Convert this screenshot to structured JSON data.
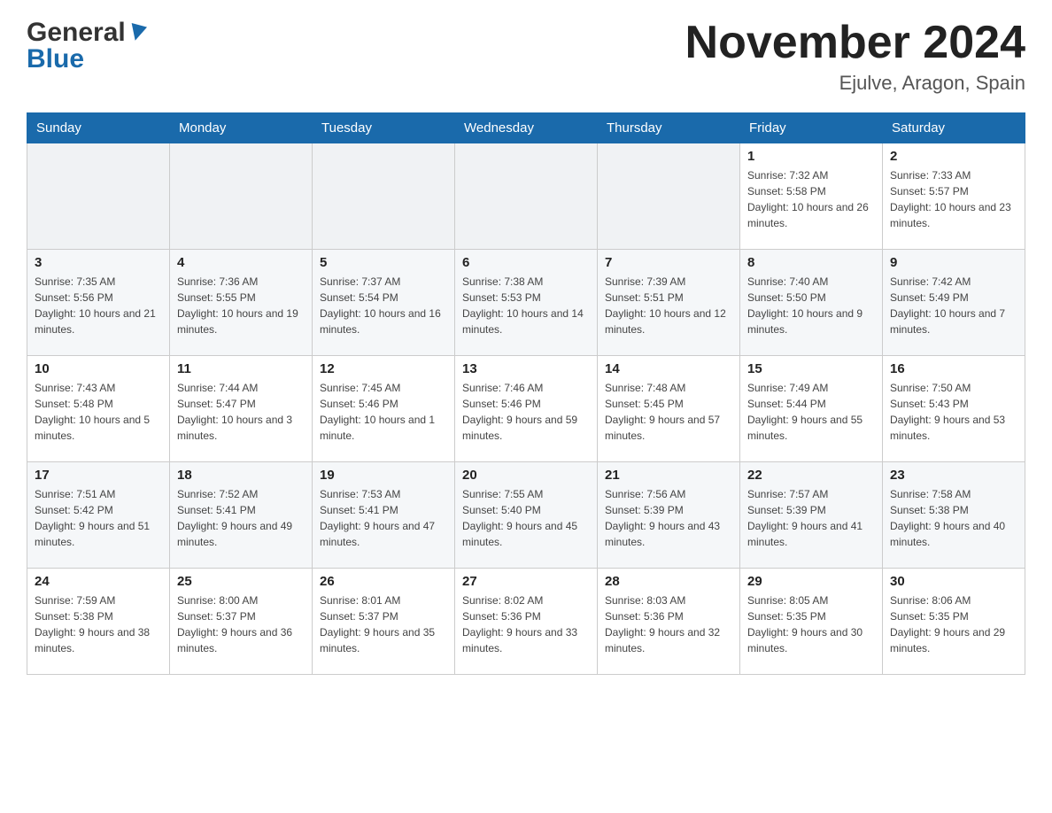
{
  "header": {
    "logo_general": "General",
    "logo_blue": "Blue",
    "month_title": "November 2024",
    "location": "Ejulve, Aragon, Spain"
  },
  "weekdays": [
    "Sunday",
    "Monday",
    "Tuesday",
    "Wednesday",
    "Thursday",
    "Friday",
    "Saturday"
  ],
  "weeks": [
    {
      "days": [
        {
          "date": "",
          "sunrise": "",
          "sunset": "",
          "daylight": ""
        },
        {
          "date": "",
          "sunrise": "",
          "sunset": "",
          "daylight": ""
        },
        {
          "date": "",
          "sunrise": "",
          "sunset": "",
          "daylight": ""
        },
        {
          "date": "",
          "sunrise": "",
          "sunset": "",
          "daylight": ""
        },
        {
          "date": "",
          "sunrise": "",
          "sunset": "",
          "daylight": ""
        },
        {
          "date": "1",
          "sunrise": "Sunrise: 7:32 AM",
          "sunset": "Sunset: 5:58 PM",
          "daylight": "Daylight: 10 hours and 26 minutes."
        },
        {
          "date": "2",
          "sunrise": "Sunrise: 7:33 AM",
          "sunset": "Sunset: 5:57 PM",
          "daylight": "Daylight: 10 hours and 23 minutes."
        }
      ]
    },
    {
      "days": [
        {
          "date": "3",
          "sunrise": "Sunrise: 7:35 AM",
          "sunset": "Sunset: 5:56 PM",
          "daylight": "Daylight: 10 hours and 21 minutes."
        },
        {
          "date": "4",
          "sunrise": "Sunrise: 7:36 AM",
          "sunset": "Sunset: 5:55 PM",
          "daylight": "Daylight: 10 hours and 19 minutes."
        },
        {
          "date": "5",
          "sunrise": "Sunrise: 7:37 AM",
          "sunset": "Sunset: 5:54 PM",
          "daylight": "Daylight: 10 hours and 16 minutes."
        },
        {
          "date": "6",
          "sunrise": "Sunrise: 7:38 AM",
          "sunset": "Sunset: 5:53 PM",
          "daylight": "Daylight: 10 hours and 14 minutes."
        },
        {
          "date": "7",
          "sunrise": "Sunrise: 7:39 AM",
          "sunset": "Sunset: 5:51 PM",
          "daylight": "Daylight: 10 hours and 12 minutes."
        },
        {
          "date": "8",
          "sunrise": "Sunrise: 7:40 AM",
          "sunset": "Sunset: 5:50 PM",
          "daylight": "Daylight: 10 hours and 9 minutes."
        },
        {
          "date": "9",
          "sunrise": "Sunrise: 7:42 AM",
          "sunset": "Sunset: 5:49 PM",
          "daylight": "Daylight: 10 hours and 7 minutes."
        }
      ]
    },
    {
      "days": [
        {
          "date": "10",
          "sunrise": "Sunrise: 7:43 AM",
          "sunset": "Sunset: 5:48 PM",
          "daylight": "Daylight: 10 hours and 5 minutes."
        },
        {
          "date": "11",
          "sunrise": "Sunrise: 7:44 AM",
          "sunset": "Sunset: 5:47 PM",
          "daylight": "Daylight: 10 hours and 3 minutes."
        },
        {
          "date": "12",
          "sunrise": "Sunrise: 7:45 AM",
          "sunset": "Sunset: 5:46 PM",
          "daylight": "Daylight: 10 hours and 1 minute."
        },
        {
          "date": "13",
          "sunrise": "Sunrise: 7:46 AM",
          "sunset": "Sunset: 5:46 PM",
          "daylight": "Daylight: 9 hours and 59 minutes."
        },
        {
          "date": "14",
          "sunrise": "Sunrise: 7:48 AM",
          "sunset": "Sunset: 5:45 PM",
          "daylight": "Daylight: 9 hours and 57 minutes."
        },
        {
          "date": "15",
          "sunrise": "Sunrise: 7:49 AM",
          "sunset": "Sunset: 5:44 PM",
          "daylight": "Daylight: 9 hours and 55 minutes."
        },
        {
          "date": "16",
          "sunrise": "Sunrise: 7:50 AM",
          "sunset": "Sunset: 5:43 PM",
          "daylight": "Daylight: 9 hours and 53 minutes."
        }
      ]
    },
    {
      "days": [
        {
          "date": "17",
          "sunrise": "Sunrise: 7:51 AM",
          "sunset": "Sunset: 5:42 PM",
          "daylight": "Daylight: 9 hours and 51 minutes."
        },
        {
          "date": "18",
          "sunrise": "Sunrise: 7:52 AM",
          "sunset": "Sunset: 5:41 PM",
          "daylight": "Daylight: 9 hours and 49 minutes."
        },
        {
          "date": "19",
          "sunrise": "Sunrise: 7:53 AM",
          "sunset": "Sunset: 5:41 PM",
          "daylight": "Daylight: 9 hours and 47 minutes."
        },
        {
          "date": "20",
          "sunrise": "Sunrise: 7:55 AM",
          "sunset": "Sunset: 5:40 PM",
          "daylight": "Daylight: 9 hours and 45 minutes."
        },
        {
          "date": "21",
          "sunrise": "Sunrise: 7:56 AM",
          "sunset": "Sunset: 5:39 PM",
          "daylight": "Daylight: 9 hours and 43 minutes."
        },
        {
          "date": "22",
          "sunrise": "Sunrise: 7:57 AM",
          "sunset": "Sunset: 5:39 PM",
          "daylight": "Daylight: 9 hours and 41 minutes."
        },
        {
          "date": "23",
          "sunrise": "Sunrise: 7:58 AM",
          "sunset": "Sunset: 5:38 PM",
          "daylight": "Daylight: 9 hours and 40 minutes."
        }
      ]
    },
    {
      "days": [
        {
          "date": "24",
          "sunrise": "Sunrise: 7:59 AM",
          "sunset": "Sunset: 5:38 PM",
          "daylight": "Daylight: 9 hours and 38 minutes."
        },
        {
          "date": "25",
          "sunrise": "Sunrise: 8:00 AM",
          "sunset": "Sunset: 5:37 PM",
          "daylight": "Daylight: 9 hours and 36 minutes."
        },
        {
          "date": "26",
          "sunrise": "Sunrise: 8:01 AM",
          "sunset": "Sunset: 5:37 PM",
          "daylight": "Daylight: 9 hours and 35 minutes."
        },
        {
          "date": "27",
          "sunrise": "Sunrise: 8:02 AM",
          "sunset": "Sunset: 5:36 PM",
          "daylight": "Daylight: 9 hours and 33 minutes."
        },
        {
          "date": "28",
          "sunrise": "Sunrise: 8:03 AM",
          "sunset": "Sunset: 5:36 PM",
          "daylight": "Daylight: 9 hours and 32 minutes."
        },
        {
          "date": "29",
          "sunrise": "Sunrise: 8:05 AM",
          "sunset": "Sunset: 5:35 PM",
          "daylight": "Daylight: 9 hours and 30 minutes."
        },
        {
          "date": "30",
          "sunrise": "Sunrise: 8:06 AM",
          "sunset": "Sunset: 5:35 PM",
          "daylight": "Daylight: 9 hours and 29 minutes."
        }
      ]
    }
  ]
}
